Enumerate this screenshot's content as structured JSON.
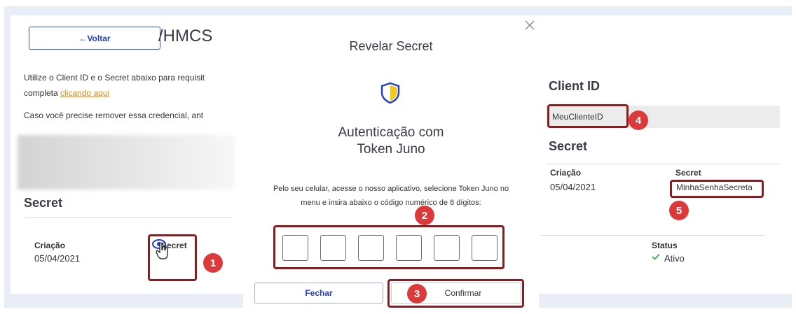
{
  "page": {
    "back_label": "←Voltar",
    "title_fragment": "/HMCS",
    "description_line1": "Utilize o Client ID e o Secret abaixo para requisit",
    "description_line2_prefix": "completa ",
    "description_link": "clicando aqui",
    "description_remove": "Caso você precise remover essa credencial, ant",
    "secret_heading": "Secret",
    "creation_label": "Criação",
    "creation_value": "05/04/2021",
    "secret_column_label": "Secret"
  },
  "right_panel": {
    "client_id_heading": "Client ID",
    "client_id_value": "MeuClienteID",
    "secret_heading": "Secret",
    "creation_label": "Criação",
    "creation_value": "05/04/2021",
    "secret_label": "Secret",
    "secret_value": "MinhaSenhaSecreta",
    "status_label": "Status",
    "status_value": "Ativo"
  },
  "modal": {
    "title": "Revelar Secret",
    "auth_title_line1": "Autenticação com",
    "auth_title_line2": "Token Juno",
    "instructions_line1": "Pelo seu celular, acesse o nosso aplicativo, selecione Token Juno no",
    "instructions_line2": "menu e insira abaixo o código numérico de 6 dígitos:",
    "code_digits": [
      "",
      "",
      "",
      "",
      "",
      ""
    ],
    "cancel_label": "Fechar",
    "confirm_label": "Confirmar"
  },
  "annotations": {
    "badges": [
      "1",
      "2",
      "3",
      "4",
      "5"
    ]
  },
  "colors": {
    "accent_blue": "#2340c6",
    "highlight": "#8c1c22",
    "badge": "#dc3a3a",
    "link": "#e38b12",
    "status_green": "#3aa845",
    "shield_yellow": "#f5c518"
  },
  "icons": [
    "close-icon",
    "shield-icon",
    "eye-icon",
    "hand-cursor-icon",
    "check-icon"
  ]
}
